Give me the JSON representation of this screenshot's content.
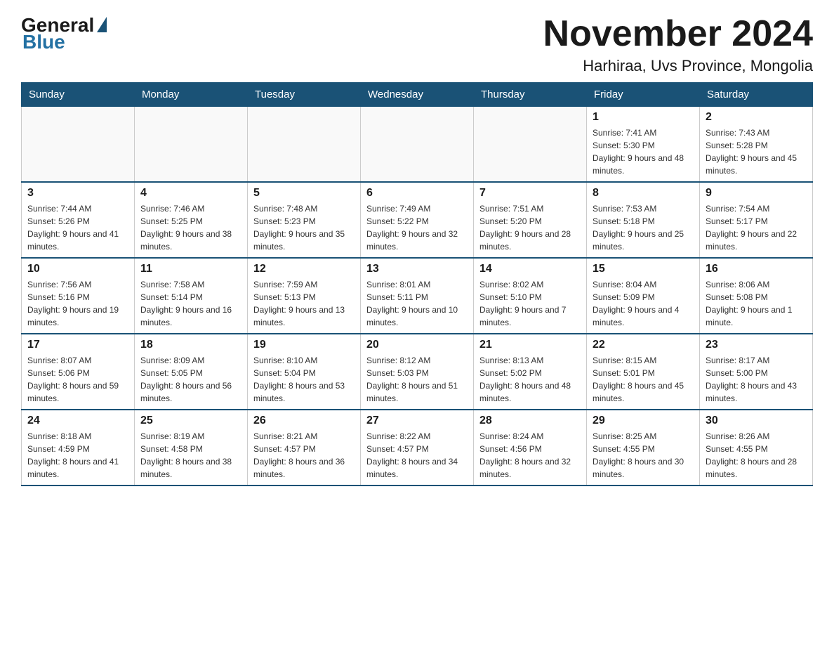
{
  "header": {
    "logo": {
      "text_general": "General",
      "text_blue": "Blue"
    },
    "title": "November 2024",
    "subtitle": "Harhiraa, Uvs Province, Mongolia"
  },
  "weekdays": [
    "Sunday",
    "Monday",
    "Tuesday",
    "Wednesday",
    "Thursday",
    "Friday",
    "Saturday"
  ],
  "weeks": [
    [
      {
        "day": "",
        "info": ""
      },
      {
        "day": "",
        "info": ""
      },
      {
        "day": "",
        "info": ""
      },
      {
        "day": "",
        "info": ""
      },
      {
        "day": "",
        "info": ""
      },
      {
        "day": "1",
        "info": "Sunrise: 7:41 AM\nSunset: 5:30 PM\nDaylight: 9 hours and 48 minutes."
      },
      {
        "day": "2",
        "info": "Sunrise: 7:43 AM\nSunset: 5:28 PM\nDaylight: 9 hours and 45 minutes."
      }
    ],
    [
      {
        "day": "3",
        "info": "Sunrise: 7:44 AM\nSunset: 5:26 PM\nDaylight: 9 hours and 41 minutes."
      },
      {
        "day": "4",
        "info": "Sunrise: 7:46 AM\nSunset: 5:25 PM\nDaylight: 9 hours and 38 minutes."
      },
      {
        "day": "5",
        "info": "Sunrise: 7:48 AM\nSunset: 5:23 PM\nDaylight: 9 hours and 35 minutes."
      },
      {
        "day": "6",
        "info": "Sunrise: 7:49 AM\nSunset: 5:22 PM\nDaylight: 9 hours and 32 minutes."
      },
      {
        "day": "7",
        "info": "Sunrise: 7:51 AM\nSunset: 5:20 PM\nDaylight: 9 hours and 28 minutes."
      },
      {
        "day": "8",
        "info": "Sunrise: 7:53 AM\nSunset: 5:18 PM\nDaylight: 9 hours and 25 minutes."
      },
      {
        "day": "9",
        "info": "Sunrise: 7:54 AM\nSunset: 5:17 PM\nDaylight: 9 hours and 22 minutes."
      }
    ],
    [
      {
        "day": "10",
        "info": "Sunrise: 7:56 AM\nSunset: 5:16 PM\nDaylight: 9 hours and 19 minutes."
      },
      {
        "day": "11",
        "info": "Sunrise: 7:58 AM\nSunset: 5:14 PM\nDaylight: 9 hours and 16 minutes."
      },
      {
        "day": "12",
        "info": "Sunrise: 7:59 AM\nSunset: 5:13 PM\nDaylight: 9 hours and 13 minutes."
      },
      {
        "day": "13",
        "info": "Sunrise: 8:01 AM\nSunset: 5:11 PM\nDaylight: 9 hours and 10 minutes."
      },
      {
        "day": "14",
        "info": "Sunrise: 8:02 AM\nSunset: 5:10 PM\nDaylight: 9 hours and 7 minutes."
      },
      {
        "day": "15",
        "info": "Sunrise: 8:04 AM\nSunset: 5:09 PM\nDaylight: 9 hours and 4 minutes."
      },
      {
        "day": "16",
        "info": "Sunrise: 8:06 AM\nSunset: 5:08 PM\nDaylight: 9 hours and 1 minute."
      }
    ],
    [
      {
        "day": "17",
        "info": "Sunrise: 8:07 AM\nSunset: 5:06 PM\nDaylight: 8 hours and 59 minutes."
      },
      {
        "day": "18",
        "info": "Sunrise: 8:09 AM\nSunset: 5:05 PM\nDaylight: 8 hours and 56 minutes."
      },
      {
        "day": "19",
        "info": "Sunrise: 8:10 AM\nSunset: 5:04 PM\nDaylight: 8 hours and 53 minutes."
      },
      {
        "day": "20",
        "info": "Sunrise: 8:12 AM\nSunset: 5:03 PM\nDaylight: 8 hours and 51 minutes."
      },
      {
        "day": "21",
        "info": "Sunrise: 8:13 AM\nSunset: 5:02 PM\nDaylight: 8 hours and 48 minutes."
      },
      {
        "day": "22",
        "info": "Sunrise: 8:15 AM\nSunset: 5:01 PM\nDaylight: 8 hours and 45 minutes."
      },
      {
        "day": "23",
        "info": "Sunrise: 8:17 AM\nSunset: 5:00 PM\nDaylight: 8 hours and 43 minutes."
      }
    ],
    [
      {
        "day": "24",
        "info": "Sunrise: 8:18 AM\nSunset: 4:59 PM\nDaylight: 8 hours and 41 minutes."
      },
      {
        "day": "25",
        "info": "Sunrise: 8:19 AM\nSunset: 4:58 PM\nDaylight: 8 hours and 38 minutes."
      },
      {
        "day": "26",
        "info": "Sunrise: 8:21 AM\nSunset: 4:57 PM\nDaylight: 8 hours and 36 minutes."
      },
      {
        "day": "27",
        "info": "Sunrise: 8:22 AM\nSunset: 4:57 PM\nDaylight: 8 hours and 34 minutes."
      },
      {
        "day": "28",
        "info": "Sunrise: 8:24 AM\nSunset: 4:56 PM\nDaylight: 8 hours and 32 minutes."
      },
      {
        "day": "29",
        "info": "Sunrise: 8:25 AM\nSunset: 4:55 PM\nDaylight: 8 hours and 30 minutes."
      },
      {
        "day": "30",
        "info": "Sunrise: 8:26 AM\nSunset: 4:55 PM\nDaylight: 8 hours and 28 minutes."
      }
    ]
  ]
}
